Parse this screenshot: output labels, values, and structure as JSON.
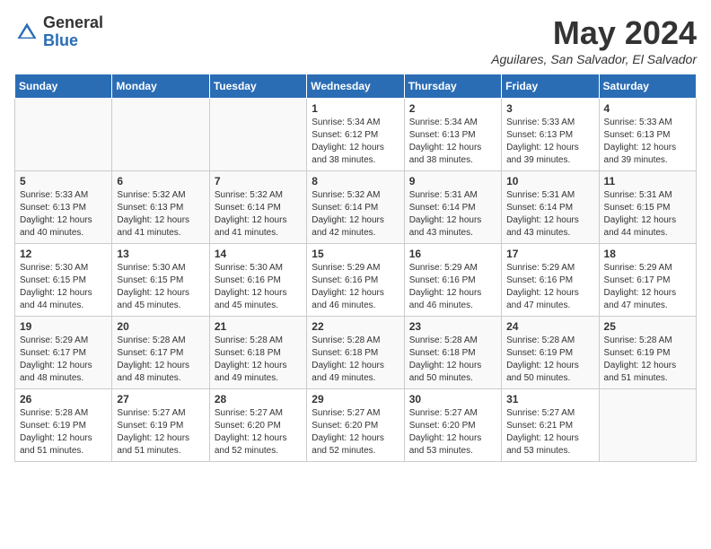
{
  "header": {
    "logo_general": "General",
    "logo_blue": "Blue",
    "month_title": "May 2024",
    "location": "Aguilares, San Salvador, El Salvador"
  },
  "days_of_week": [
    "Sunday",
    "Monday",
    "Tuesday",
    "Wednesday",
    "Thursday",
    "Friday",
    "Saturday"
  ],
  "weeks": [
    [
      {
        "num": "",
        "info": ""
      },
      {
        "num": "",
        "info": ""
      },
      {
        "num": "",
        "info": ""
      },
      {
        "num": "1",
        "info": "Sunrise: 5:34 AM\nSunset: 6:12 PM\nDaylight: 12 hours\nand 38 minutes."
      },
      {
        "num": "2",
        "info": "Sunrise: 5:34 AM\nSunset: 6:13 PM\nDaylight: 12 hours\nand 38 minutes."
      },
      {
        "num": "3",
        "info": "Sunrise: 5:33 AM\nSunset: 6:13 PM\nDaylight: 12 hours\nand 39 minutes."
      },
      {
        "num": "4",
        "info": "Sunrise: 5:33 AM\nSunset: 6:13 PM\nDaylight: 12 hours\nand 39 minutes."
      }
    ],
    [
      {
        "num": "5",
        "info": "Sunrise: 5:33 AM\nSunset: 6:13 PM\nDaylight: 12 hours\nand 40 minutes."
      },
      {
        "num": "6",
        "info": "Sunrise: 5:32 AM\nSunset: 6:13 PM\nDaylight: 12 hours\nand 41 minutes."
      },
      {
        "num": "7",
        "info": "Sunrise: 5:32 AM\nSunset: 6:14 PM\nDaylight: 12 hours\nand 41 minutes."
      },
      {
        "num": "8",
        "info": "Sunrise: 5:32 AM\nSunset: 6:14 PM\nDaylight: 12 hours\nand 42 minutes."
      },
      {
        "num": "9",
        "info": "Sunrise: 5:31 AM\nSunset: 6:14 PM\nDaylight: 12 hours\nand 43 minutes."
      },
      {
        "num": "10",
        "info": "Sunrise: 5:31 AM\nSunset: 6:14 PM\nDaylight: 12 hours\nand 43 minutes."
      },
      {
        "num": "11",
        "info": "Sunrise: 5:31 AM\nSunset: 6:15 PM\nDaylight: 12 hours\nand 44 minutes."
      }
    ],
    [
      {
        "num": "12",
        "info": "Sunrise: 5:30 AM\nSunset: 6:15 PM\nDaylight: 12 hours\nand 44 minutes."
      },
      {
        "num": "13",
        "info": "Sunrise: 5:30 AM\nSunset: 6:15 PM\nDaylight: 12 hours\nand 45 minutes."
      },
      {
        "num": "14",
        "info": "Sunrise: 5:30 AM\nSunset: 6:16 PM\nDaylight: 12 hours\nand 45 minutes."
      },
      {
        "num": "15",
        "info": "Sunrise: 5:29 AM\nSunset: 6:16 PM\nDaylight: 12 hours\nand 46 minutes."
      },
      {
        "num": "16",
        "info": "Sunrise: 5:29 AM\nSunset: 6:16 PM\nDaylight: 12 hours\nand 46 minutes."
      },
      {
        "num": "17",
        "info": "Sunrise: 5:29 AM\nSunset: 6:16 PM\nDaylight: 12 hours\nand 47 minutes."
      },
      {
        "num": "18",
        "info": "Sunrise: 5:29 AM\nSunset: 6:17 PM\nDaylight: 12 hours\nand 47 minutes."
      }
    ],
    [
      {
        "num": "19",
        "info": "Sunrise: 5:29 AM\nSunset: 6:17 PM\nDaylight: 12 hours\nand 48 minutes."
      },
      {
        "num": "20",
        "info": "Sunrise: 5:28 AM\nSunset: 6:17 PM\nDaylight: 12 hours\nand 48 minutes."
      },
      {
        "num": "21",
        "info": "Sunrise: 5:28 AM\nSunset: 6:18 PM\nDaylight: 12 hours\nand 49 minutes."
      },
      {
        "num": "22",
        "info": "Sunrise: 5:28 AM\nSunset: 6:18 PM\nDaylight: 12 hours\nand 49 minutes."
      },
      {
        "num": "23",
        "info": "Sunrise: 5:28 AM\nSunset: 6:18 PM\nDaylight: 12 hours\nand 50 minutes."
      },
      {
        "num": "24",
        "info": "Sunrise: 5:28 AM\nSunset: 6:19 PM\nDaylight: 12 hours\nand 50 minutes."
      },
      {
        "num": "25",
        "info": "Sunrise: 5:28 AM\nSunset: 6:19 PM\nDaylight: 12 hours\nand 51 minutes."
      }
    ],
    [
      {
        "num": "26",
        "info": "Sunrise: 5:28 AM\nSunset: 6:19 PM\nDaylight: 12 hours\nand 51 minutes."
      },
      {
        "num": "27",
        "info": "Sunrise: 5:27 AM\nSunset: 6:19 PM\nDaylight: 12 hours\nand 51 minutes."
      },
      {
        "num": "28",
        "info": "Sunrise: 5:27 AM\nSunset: 6:20 PM\nDaylight: 12 hours\nand 52 minutes."
      },
      {
        "num": "29",
        "info": "Sunrise: 5:27 AM\nSunset: 6:20 PM\nDaylight: 12 hours\nand 52 minutes."
      },
      {
        "num": "30",
        "info": "Sunrise: 5:27 AM\nSunset: 6:20 PM\nDaylight: 12 hours\nand 53 minutes."
      },
      {
        "num": "31",
        "info": "Sunrise: 5:27 AM\nSunset: 6:21 PM\nDaylight: 12 hours\nand 53 minutes."
      },
      {
        "num": "",
        "info": ""
      }
    ]
  ]
}
